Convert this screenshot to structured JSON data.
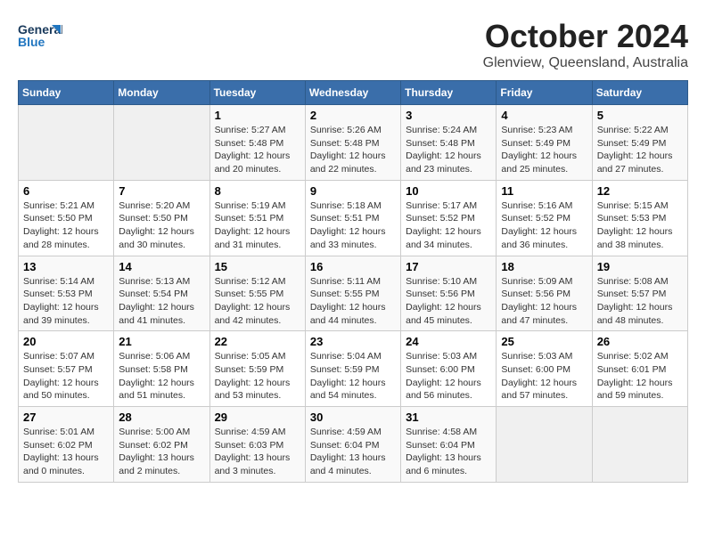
{
  "header": {
    "logo_general": "General",
    "logo_blue": "Blue",
    "month": "October 2024",
    "location": "Glenview, Queensland, Australia"
  },
  "days_of_week": [
    "Sunday",
    "Monday",
    "Tuesday",
    "Wednesday",
    "Thursday",
    "Friday",
    "Saturday"
  ],
  "weeks": [
    [
      {
        "day": "",
        "info": ""
      },
      {
        "day": "",
        "info": ""
      },
      {
        "day": "1",
        "info": "Sunrise: 5:27 AM\nSunset: 5:48 PM\nDaylight: 12 hours and 20 minutes."
      },
      {
        "day": "2",
        "info": "Sunrise: 5:26 AM\nSunset: 5:48 PM\nDaylight: 12 hours and 22 minutes."
      },
      {
        "day": "3",
        "info": "Sunrise: 5:24 AM\nSunset: 5:48 PM\nDaylight: 12 hours and 23 minutes."
      },
      {
        "day": "4",
        "info": "Sunrise: 5:23 AM\nSunset: 5:49 PM\nDaylight: 12 hours and 25 minutes."
      },
      {
        "day": "5",
        "info": "Sunrise: 5:22 AM\nSunset: 5:49 PM\nDaylight: 12 hours and 27 minutes."
      }
    ],
    [
      {
        "day": "6",
        "info": "Sunrise: 5:21 AM\nSunset: 5:50 PM\nDaylight: 12 hours and 28 minutes."
      },
      {
        "day": "7",
        "info": "Sunrise: 5:20 AM\nSunset: 5:50 PM\nDaylight: 12 hours and 30 minutes."
      },
      {
        "day": "8",
        "info": "Sunrise: 5:19 AM\nSunset: 5:51 PM\nDaylight: 12 hours and 31 minutes."
      },
      {
        "day": "9",
        "info": "Sunrise: 5:18 AM\nSunset: 5:51 PM\nDaylight: 12 hours and 33 minutes."
      },
      {
        "day": "10",
        "info": "Sunrise: 5:17 AM\nSunset: 5:52 PM\nDaylight: 12 hours and 34 minutes."
      },
      {
        "day": "11",
        "info": "Sunrise: 5:16 AM\nSunset: 5:52 PM\nDaylight: 12 hours and 36 minutes."
      },
      {
        "day": "12",
        "info": "Sunrise: 5:15 AM\nSunset: 5:53 PM\nDaylight: 12 hours and 38 minutes."
      }
    ],
    [
      {
        "day": "13",
        "info": "Sunrise: 5:14 AM\nSunset: 5:53 PM\nDaylight: 12 hours and 39 minutes."
      },
      {
        "day": "14",
        "info": "Sunrise: 5:13 AM\nSunset: 5:54 PM\nDaylight: 12 hours and 41 minutes."
      },
      {
        "day": "15",
        "info": "Sunrise: 5:12 AM\nSunset: 5:55 PM\nDaylight: 12 hours and 42 minutes."
      },
      {
        "day": "16",
        "info": "Sunrise: 5:11 AM\nSunset: 5:55 PM\nDaylight: 12 hours and 44 minutes."
      },
      {
        "day": "17",
        "info": "Sunrise: 5:10 AM\nSunset: 5:56 PM\nDaylight: 12 hours and 45 minutes."
      },
      {
        "day": "18",
        "info": "Sunrise: 5:09 AM\nSunset: 5:56 PM\nDaylight: 12 hours and 47 minutes."
      },
      {
        "day": "19",
        "info": "Sunrise: 5:08 AM\nSunset: 5:57 PM\nDaylight: 12 hours and 48 minutes."
      }
    ],
    [
      {
        "day": "20",
        "info": "Sunrise: 5:07 AM\nSunset: 5:57 PM\nDaylight: 12 hours and 50 minutes."
      },
      {
        "day": "21",
        "info": "Sunrise: 5:06 AM\nSunset: 5:58 PM\nDaylight: 12 hours and 51 minutes."
      },
      {
        "day": "22",
        "info": "Sunrise: 5:05 AM\nSunset: 5:59 PM\nDaylight: 12 hours and 53 minutes."
      },
      {
        "day": "23",
        "info": "Sunrise: 5:04 AM\nSunset: 5:59 PM\nDaylight: 12 hours and 54 minutes."
      },
      {
        "day": "24",
        "info": "Sunrise: 5:03 AM\nSunset: 6:00 PM\nDaylight: 12 hours and 56 minutes."
      },
      {
        "day": "25",
        "info": "Sunrise: 5:03 AM\nSunset: 6:00 PM\nDaylight: 12 hours and 57 minutes."
      },
      {
        "day": "26",
        "info": "Sunrise: 5:02 AM\nSunset: 6:01 PM\nDaylight: 12 hours and 59 minutes."
      }
    ],
    [
      {
        "day": "27",
        "info": "Sunrise: 5:01 AM\nSunset: 6:02 PM\nDaylight: 13 hours and 0 minutes."
      },
      {
        "day": "28",
        "info": "Sunrise: 5:00 AM\nSunset: 6:02 PM\nDaylight: 13 hours and 2 minutes."
      },
      {
        "day": "29",
        "info": "Sunrise: 4:59 AM\nSunset: 6:03 PM\nDaylight: 13 hours and 3 minutes."
      },
      {
        "day": "30",
        "info": "Sunrise: 4:59 AM\nSunset: 6:04 PM\nDaylight: 13 hours and 4 minutes."
      },
      {
        "day": "31",
        "info": "Sunrise: 4:58 AM\nSunset: 6:04 PM\nDaylight: 13 hours and 6 minutes."
      },
      {
        "day": "",
        "info": ""
      },
      {
        "day": "",
        "info": ""
      }
    ]
  ]
}
